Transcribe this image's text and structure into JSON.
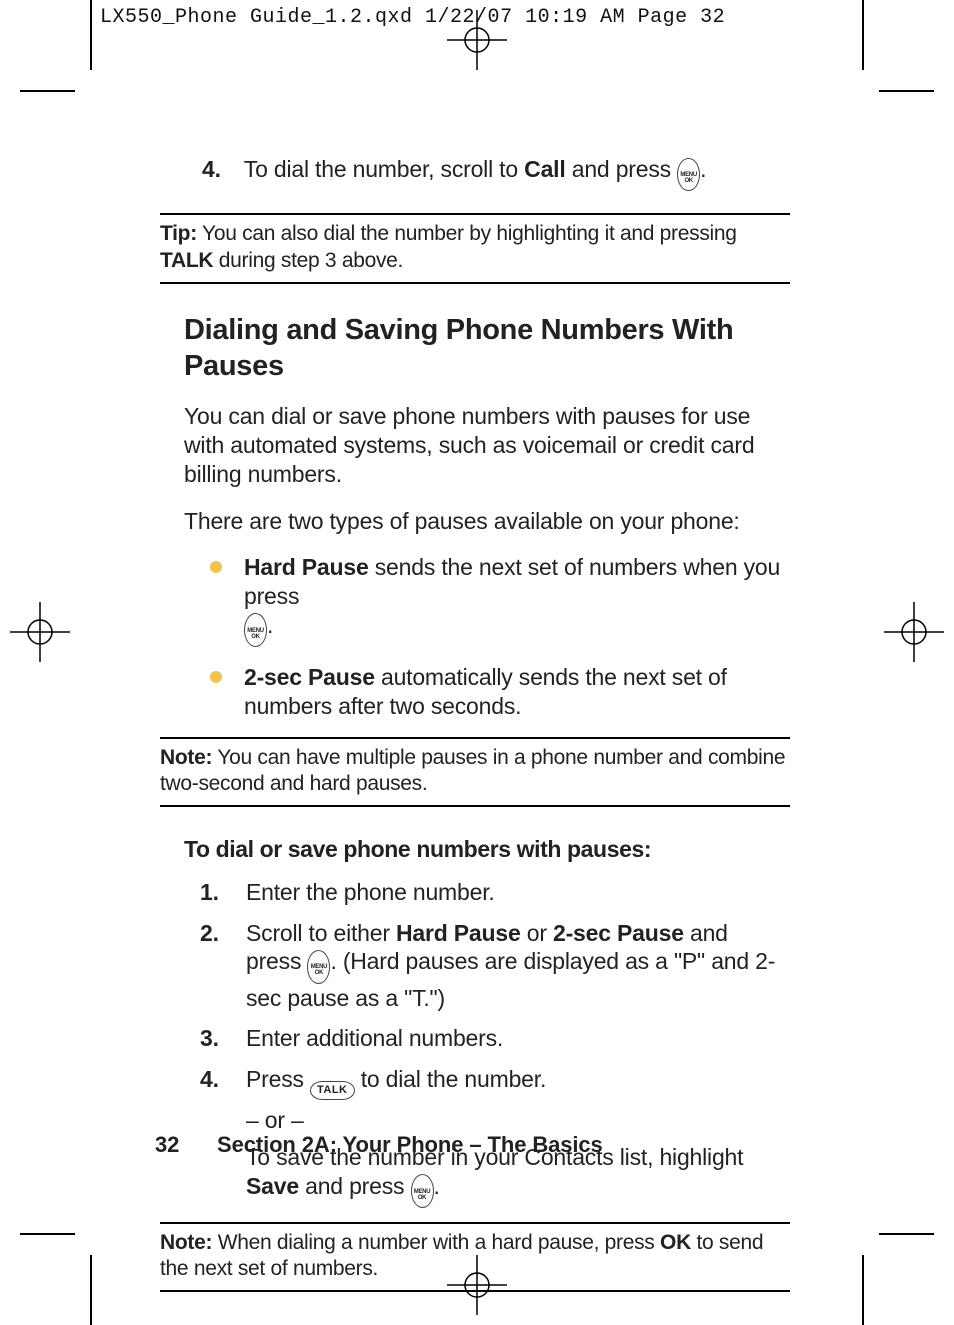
{
  "crop_header": "LX550_Phone Guide_1.2.qxd  1/22/07  10:19 AM  Page 32",
  "top_step": {
    "num": "4.",
    "pre": "To dial the number, scroll to ",
    "bold": "Call",
    "post": " and press ",
    "key": "MENU OK",
    "period": "."
  },
  "tip_box": {
    "label": "Tip:",
    "body1": " You can also dial the number by highlighting it and pressing ",
    "bold": "TALK",
    "body2": " during step 3 above."
  },
  "section_title": "Dialing and Saving Phone Numbers With Pauses",
  "para1": "You can dial or save phone numbers with pauses for use with automated systems, such as voicemail or credit card billing numbers.",
  "para2": "There are two types of pauses available on your phone:",
  "bullets": [
    {
      "bold": "Hard Pause",
      "body": " sends the next set of numbers when you press ",
      "key": "MENU OK",
      "period": "."
    },
    {
      "bold": "2-sec Pause",
      "body": " automatically sends the next set of numbers after two seconds."
    }
  ],
  "note1": {
    "label": "Note:",
    "body": " You can have multiple pauses in a phone number and combine two-second and hard pauses."
  },
  "subhead": "To dial or save phone numbers with pauses:",
  "steps": [
    {
      "num": "1.",
      "body": "Enter the phone number."
    },
    {
      "num": "2.",
      "pre": "Scroll to either ",
      "bold1": "Hard Pause",
      "mid1": " or ",
      "bold2": "2-sec Pause",
      "mid2": " and press ",
      "key": "MENU OK",
      "post": ". (Hard pauses are displayed as a \"P\" and 2-sec pause as a \"T.\")"
    },
    {
      "num": "3.",
      "body": "Enter additional numbers."
    },
    {
      "num": "4.",
      "pre": "Press ",
      "key": "TALK",
      "post": " to dial the number.",
      "or": "– or –",
      "save_pre": "To save the number in your Contacts list, highlight ",
      "save_bold": "Save",
      "save_mid": " and press ",
      "save_key": "MENU OK",
      "save_post": "."
    }
  ],
  "note2": {
    "label": "Note:",
    "pre": " When dialing a number with a hard pause, press ",
    "bold": "OK",
    "post": " to send the next set of numbers."
  },
  "footer": {
    "page": "32",
    "section": "Section 2A: Your Phone – The Basics"
  }
}
